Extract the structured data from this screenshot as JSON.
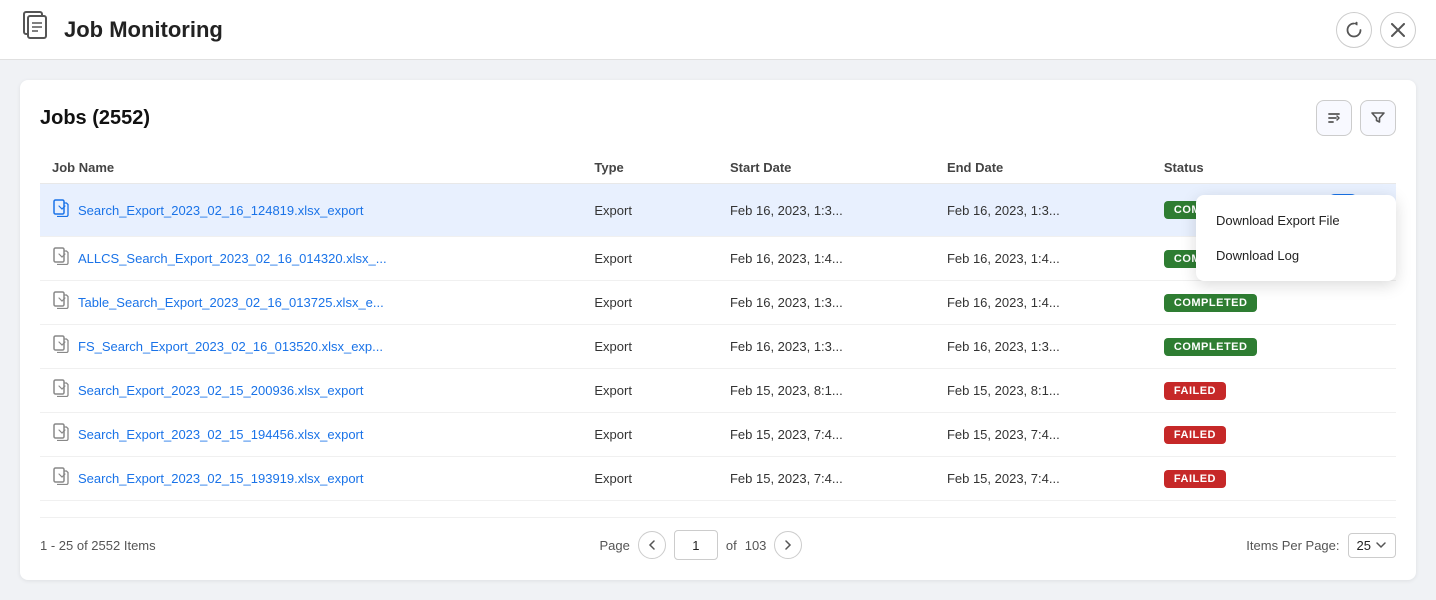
{
  "header": {
    "title": "Job Monitoring",
    "icon": "📋",
    "refresh_label": "↻",
    "close_label": "✕"
  },
  "section": {
    "title": "Jobs (2552)",
    "sort_icon": "⇅",
    "filter_icon": "⊽"
  },
  "table": {
    "columns": [
      "Job Name",
      "Type",
      "Start Date",
      "End Date",
      "Status"
    ],
    "rows": [
      {
        "name": "Search_Export_2023_02_16_124819.xlsx_export",
        "type": "Export",
        "start": "Feb 16, 2023, 1:3...",
        "end": "Feb 16, 2023, 1:3...",
        "status": "COMPLETED",
        "selected": true
      },
      {
        "name": "ALLCS_Search_Export_2023_02_16_014320.xlsx_...",
        "type": "Export",
        "start": "Feb 16, 2023, 1:4...",
        "end": "Feb 16, 2023, 1:4...",
        "status": "COMPLETED",
        "selected": false
      },
      {
        "name": "Table_Search_Export_2023_02_16_013725.xlsx_e...",
        "type": "Export",
        "start": "Feb 16, 2023, 1:3...",
        "end": "Feb 16, 2023, 1:4...",
        "status": "COMPLETED",
        "selected": false
      },
      {
        "name": "FS_Search_Export_2023_02_16_013520.xlsx_exp...",
        "type": "Export",
        "start": "Feb 16, 2023, 1:3...",
        "end": "Feb 16, 2023, 1:3...",
        "status": "COMPLETED",
        "selected": false
      },
      {
        "name": "Search_Export_2023_02_15_200936.xlsx_export",
        "type": "Export",
        "start": "Feb 15, 2023, 8:1...",
        "end": "Feb 15, 2023, 8:1...",
        "status": "FAILED",
        "selected": false
      },
      {
        "name": "Search_Export_2023_02_15_194456.xlsx_export",
        "type": "Export",
        "start": "Feb 15, 2023, 7:4...",
        "end": "Feb 15, 2023, 7:4...",
        "status": "FAILED",
        "selected": false
      },
      {
        "name": "Search_Export_2023_02_15_193919.xlsx_export",
        "type": "Export",
        "start": "Feb 15, 2023, 7:4...",
        "end": "Feb 15, 2023, 7:4...",
        "status": "FAILED",
        "selected": false
      }
    ]
  },
  "context_menu": {
    "items": [
      "Download Export File",
      "Download Log"
    ]
  },
  "pagination": {
    "range": "1 - 25 of 2552 Items",
    "page_label": "Page",
    "current_page": "1",
    "total_pages": "103",
    "of_label": "of",
    "items_per_page_label": "Items Per Page:",
    "items_per_page_value": "25"
  }
}
